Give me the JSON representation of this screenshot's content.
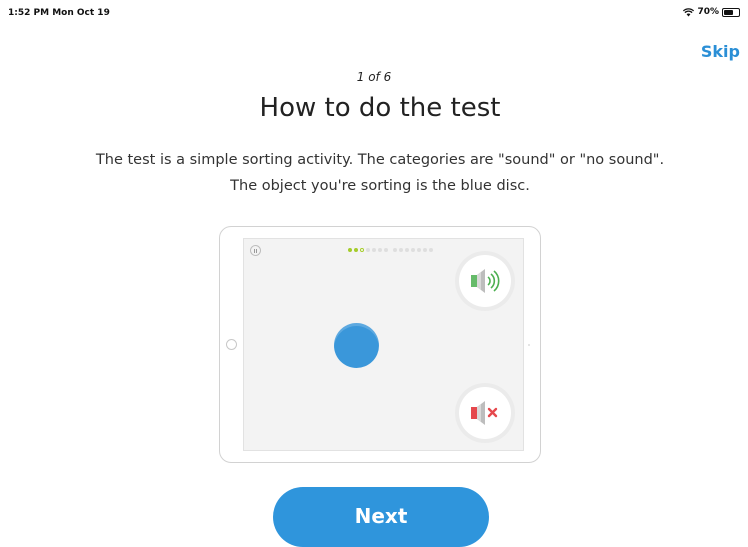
{
  "status_bar": {
    "time": "1:52 PM  Mon Oct 19",
    "battery_percent": "70%",
    "battery_level": 0.7,
    "wifi_icon": "wifi-icon",
    "battery_icon": "battery-icon"
  },
  "header": {
    "skip_label": "Skip"
  },
  "main": {
    "step": "1 of 6",
    "title": "How to do the test",
    "description_line1": "The test is a simple sorting activity. The categories are \"sound\" or \"no sound\".",
    "description_line2": "The object you're sorting is the blue disc."
  },
  "illustration": {
    "progress_total": 14,
    "progress_completed": 2,
    "progress_current": 3,
    "sound_icon": "speaker-sound-icon",
    "no_sound_icon": "speaker-muted-icon",
    "disc_color": "#3a97da",
    "sound_color": "#4caf50",
    "mute_color": "#e5484d"
  },
  "footer": {
    "next_label": "Next"
  },
  "colors": {
    "accent": "#2f95dc",
    "progress": "#a5cc2a"
  }
}
